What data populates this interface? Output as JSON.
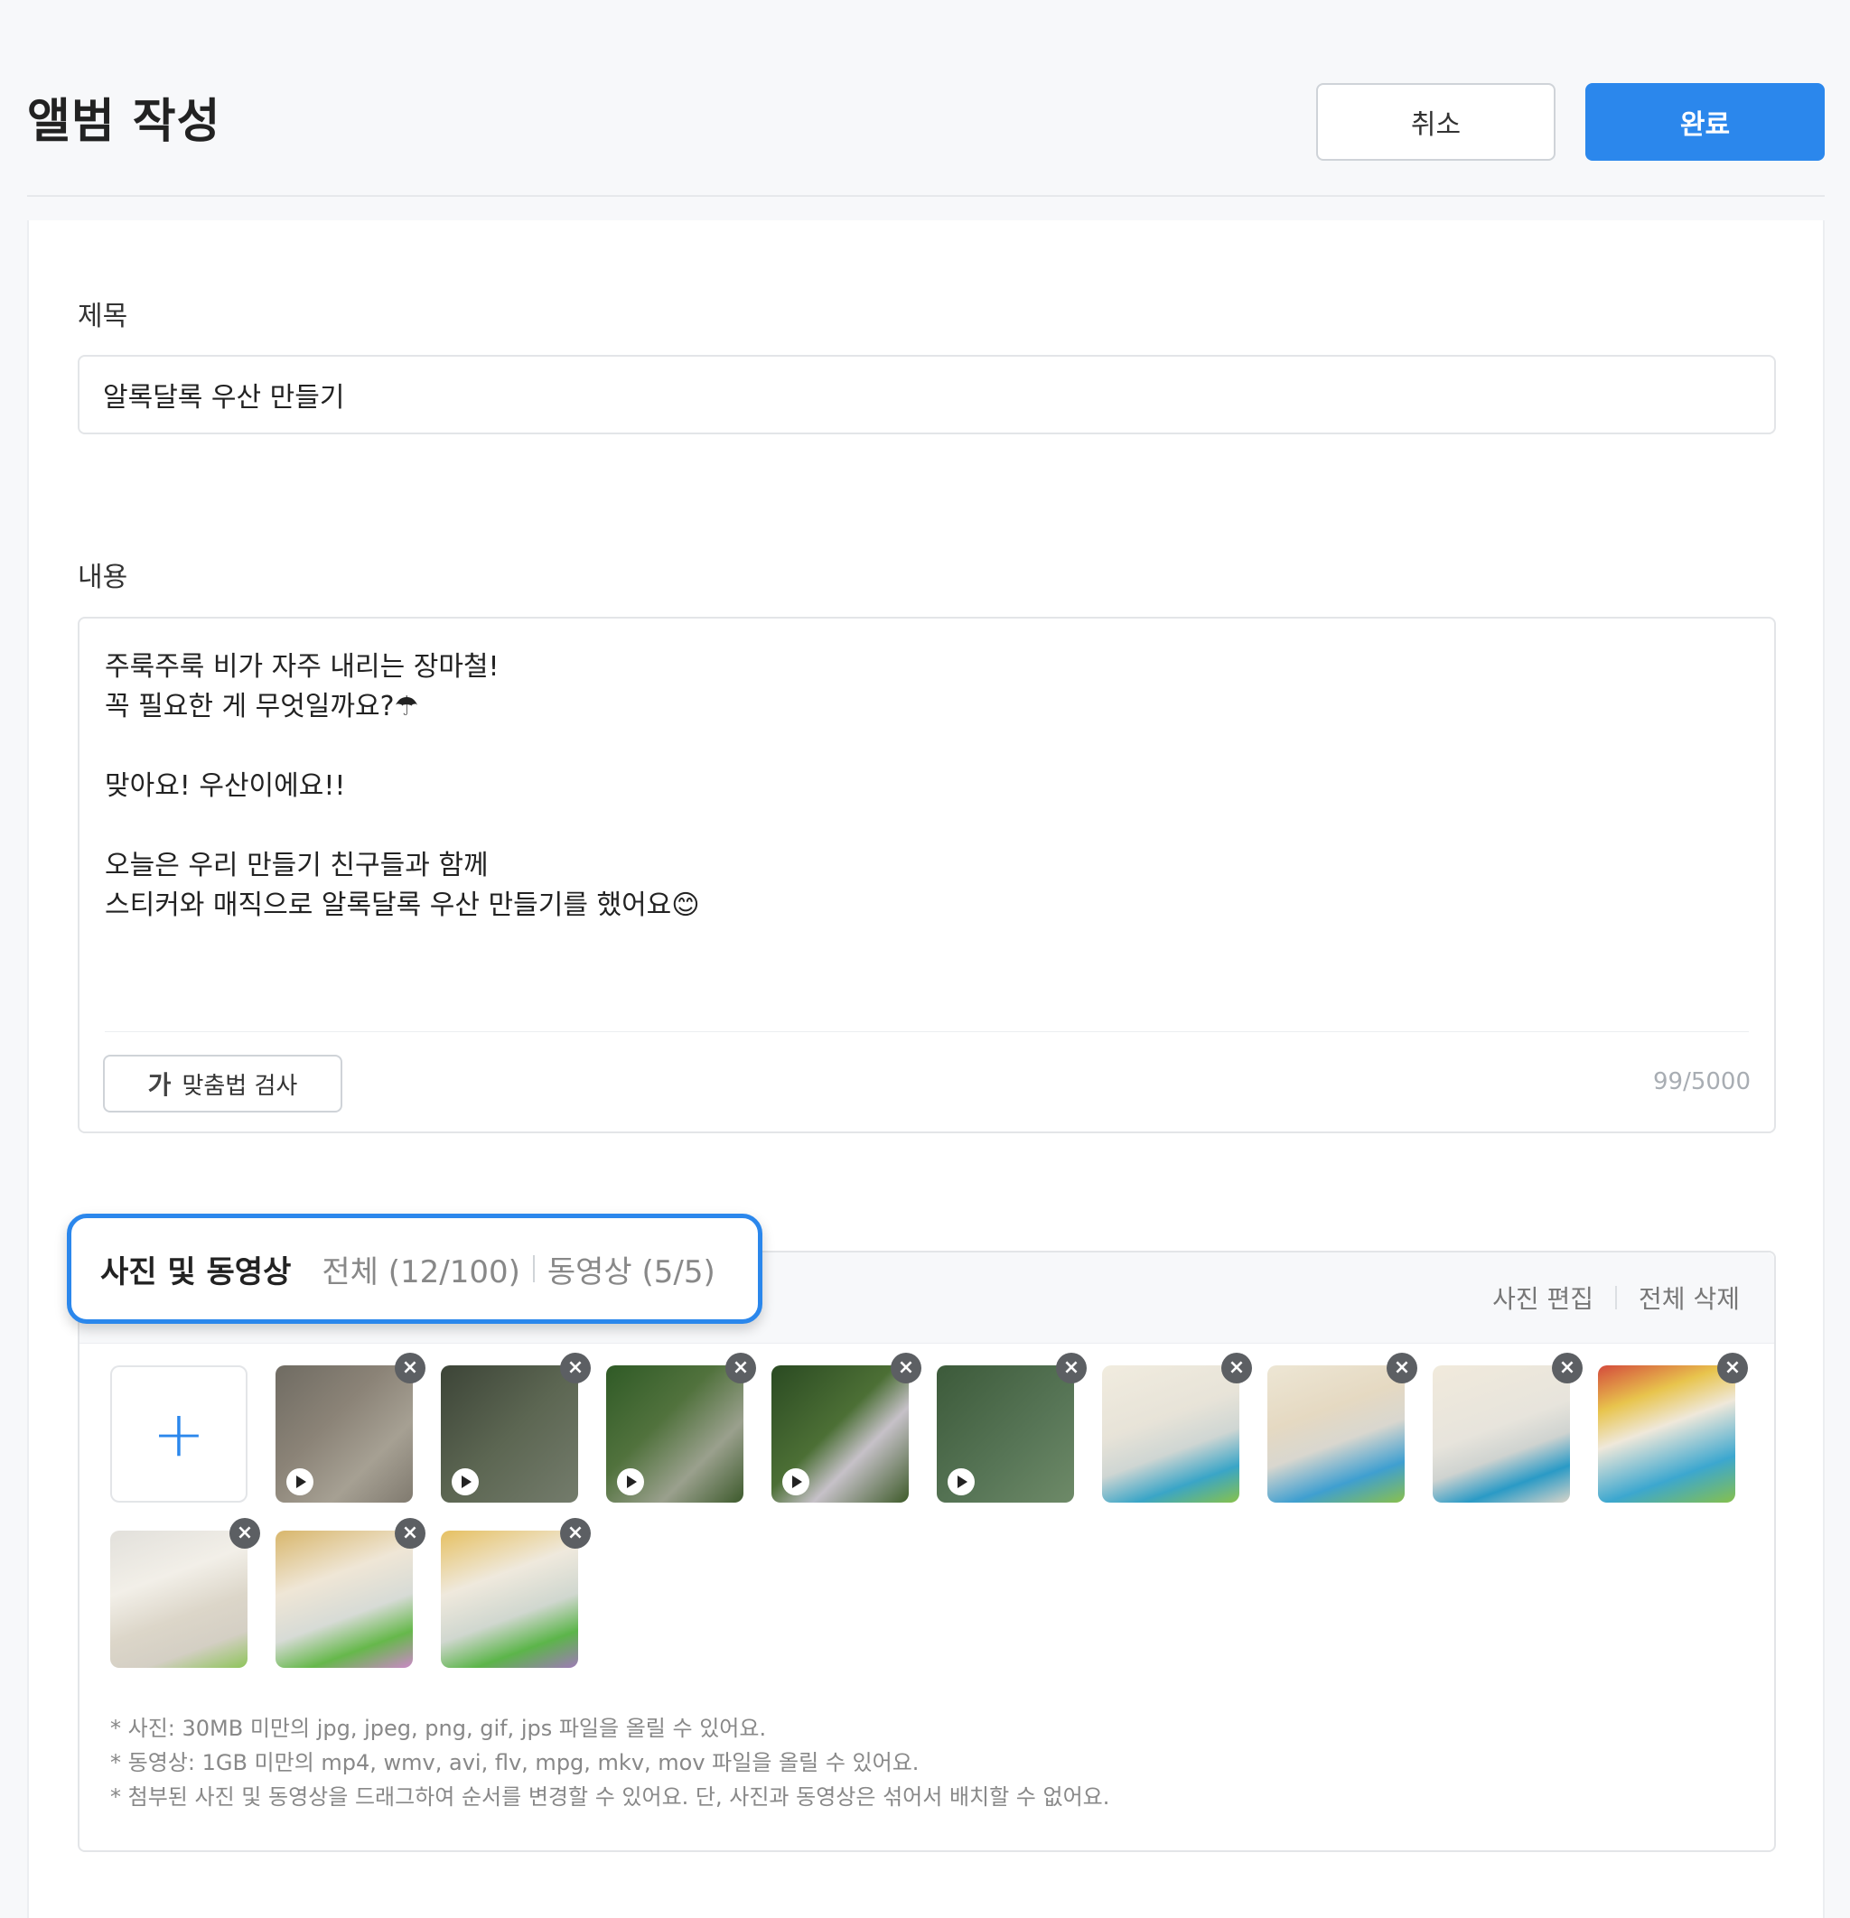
{
  "header": {
    "title": "앨범 작성",
    "cancel_label": "취소",
    "done_label": "완료"
  },
  "form": {
    "title_label": "제목",
    "title_value": "알록달록 우산 만들기",
    "content_label": "내용",
    "content_value": "주룩주룩 비가 자주 내리는 장마철!\n꼭 필요한 게 무엇일까요?☂\n\n맞아요! 우산이에요!!\n\n오늘은 우리 만들기 친구들과 함께\n스티커와 매직으로 알록달록 우산 만들기를 했어요😊",
    "spell_check_label": "맞춤법 검사",
    "spell_check_icon": "spell-check-icon",
    "char_count": "99/5000"
  },
  "media": {
    "section_title": "사진 및 동영상",
    "total_count": "전체 (12/100)",
    "video_count": "동영상 (5/5)",
    "edit_label": "사진 편집",
    "delete_all_label": "전체 삭제",
    "add_icon": "plus-icon",
    "remove_icon": "close-icon",
    "play_icon": "play-icon",
    "notes": [
      "* 사진: 30MB 미만의 jpg, jpeg, png, gif, jps 파일을 올릴 수 있어요.",
      "* 동영상: 1GB 미만의 mp4, wmv, avi, flv, mpg, mkv, mov 파일을 올릴 수 있어요.",
      "* 첨부된 사진 및 동영상을 드래그하여 순서를 변경할 수 있어요. 단, 사진과 동영상은 섞어서 배치할 수 없어요."
    ]
  },
  "colors": {
    "accent": "#2b87ec",
    "background": "#f7f8fa",
    "border": "#e3e5e8"
  }
}
